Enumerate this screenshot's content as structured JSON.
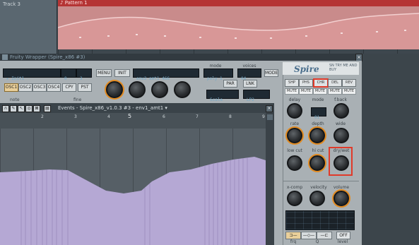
{
  "playlist": {
    "track_label": "Track 3",
    "pattern_label": "♪ Pattern 1"
  },
  "plugin": {
    "title": "Fruity Wrapper (Spire_x86 #3)",
    "preset_name": "▸ Init1",
    "preset_num1": "0",
    "preset_num2": "3",
    "menu_label": "MENU",
    "init_label": "INIT",
    "mod_display": "env2 amt1  466",
    "mode_label": "mode",
    "mode_value": "poly 1",
    "voices_label": "voices",
    "voices_value": "04",
    "mode_btn": "MODE",
    "osc_buttons": [
      "OSC1",
      "OSC2",
      "OSC3",
      "OSC4"
    ],
    "cpy_label": "CPY",
    "pst_label": "PST",
    "note_label": "note",
    "fine_label": "fine",
    "par_label": "PAR",
    "lnk_label": "LNK",
    "filter_display": "Scale",
    "filter_type": "LP2",
    "logo": "Spire",
    "logo_sub": "SN TRY ME AND BUY",
    "fx_tabs": [
      "SHP",
      "PHS",
      "CHR",
      "DEL",
      "REV"
    ],
    "mute_labels": [
      "MUTE",
      "MUTE",
      "MUTE",
      "MUTE",
      "MUTE"
    ],
    "fx_labels": {
      "delay": "delay",
      "mode": "mode",
      "fback": "f.back",
      "mode_value": "01",
      "rate": "rate",
      "depth": "depth",
      "wide": "wide",
      "low_cut": "low cut",
      "hi_cut": "hi cut",
      "dry_wet": "dry/wet",
      "xcomp": "x-comp",
      "velocity": "velocity",
      "volume": "volume",
      "frq": "frq",
      "q": "Q",
      "level": "level",
      "off": "OFF"
    }
  },
  "events": {
    "title": "Events - Spire_x86_v1.0.3 #3 - env1_amt1 ▾",
    "ruler": [
      "2",
      "3",
      "4",
      "5",
      "6",
      "7",
      "8",
      "9"
    ]
  },
  "colors": {
    "accent_orange": "#e38a1e",
    "highlight_red": "#e03a2a",
    "automation_fill": "#b5a8d4"
  }
}
